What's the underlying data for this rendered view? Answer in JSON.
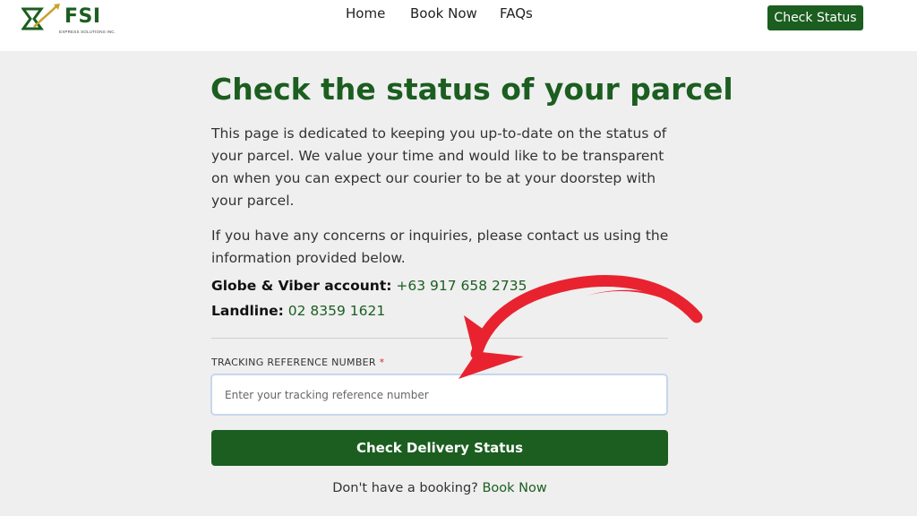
{
  "header": {
    "logo_text": "FSI",
    "logo_subtext": "EXPRESS SOLUTIONS INC.",
    "nav": [
      {
        "label": "Home"
      },
      {
        "label": "Book Now"
      },
      {
        "label": "FAQs"
      }
    ],
    "check_status_label": "Check Status"
  },
  "main": {
    "title": "Check the status of your parcel",
    "intro": "This page is dedicated to keeping you up-to-date on the status of your parcel. We value your time and would like to be transparent on when you can expect our courier to be at your doorstep with your parcel.",
    "contact_intro": "If you have any concerns or inquiries, please contact us using the information provided below.",
    "globe_label": "Globe & Viber account:",
    "globe_value": "+63 917 658 2735",
    "landline_label": "Landline:",
    "landline_value": "02 8359 1621"
  },
  "form": {
    "field_label": "TRACKING REFERENCE NUMBER",
    "required_mark": "*",
    "placeholder": "Enter your tracking reference number",
    "value": "",
    "submit_label": "Check Delivery Status"
  },
  "footer": {
    "prompt": "Don't have a booking?",
    "link_label": "Book Now"
  },
  "colors": {
    "brand_green": "#1b5e20",
    "annotation_arrow": "#e8232f",
    "background": "#efefef"
  }
}
